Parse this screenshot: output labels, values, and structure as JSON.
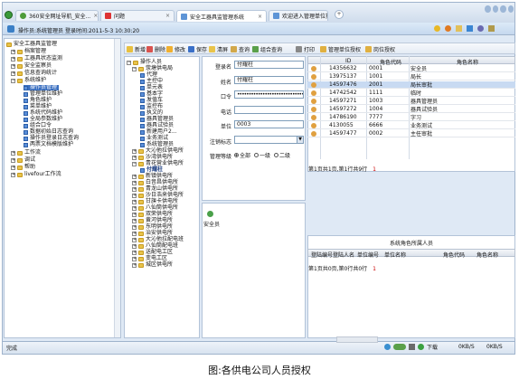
{
  "browser": {
    "tabs": [
      {
        "label": "360安全网址导航_安全..."
      },
      {
        "label": "问题"
      },
      {
        "label": "安全工器具监管理系统"
      },
      {
        "label": "欢迎进入管理单位授权"
      }
    ],
    "new_tab": "+"
  },
  "header": {
    "user": "操作员:系统管理员",
    "login_time": "登录时间:2011-5-3 10:30:20"
  },
  "left_tree": {
    "root": "安全工器具监管理",
    "items": [
      "档案管理",
      "工器具状态监测",
      "安全监察员",
      "信息查询统计",
      "系统维护",
      "操作员管理",
      "管理单位维护",
      "角色维护",
      "菜单维护",
      "系统代码维护",
      "全局参数维护",
      "组合口令",
      "数据初始日志查询",
      "操作员登录日志查询",
      "两票文档模版维护",
      "工作流",
      "调试",
      "帮助",
      "livefour工作流"
    ]
  },
  "toolbar": {
    "buttons": [
      "新增",
      "删除",
      "修改",
      "保存",
      "清屏",
      "查询",
      "组合查询",
      "打印",
      "管理单位授权",
      "岗位授权"
    ]
  },
  "org_tree": {
    "root": "操作人员",
    "items": [
      "荥塘供电局",
      "代理",
      "主控中",
      "单元表",
      "基本字",
      "发值车",
      "监控布",
      "执文的",
      "器具管理员",
      "器具试验员",
      "新建用户2...",
      "业务测试",
      "系统管理员",
      "大沁他拉供电所",
      "沙湾供电所",
      "青花营业供电所",
      "付耀柱",
      "新镇供电所",
      "白音昌供电所",
      "青龙山供电所",
      "沙日浩来供电所",
      "甘旗卡供电所",
      "八仙筒供电所",
      "双荣供电所",
      "黄河供电所",
      "东明供电所",
      "治安供电所",
      "大沁他拉配电班",
      "八仙筒配电班",
      "送配电工区",
      "变电工区",
      "城区供电所"
    ]
  },
  "form": {
    "login_name_label": "登录名",
    "login_name": "付耀柱",
    "name_label": "姓名",
    "name": "付耀柱",
    "password_label": "口令",
    "password": "••••••••••••••••••••••••••••••••••••••",
    "phone_label": "电话",
    "phone": "",
    "unit_label": "单位",
    "unit": "0003",
    "cancel_flag_label": "注销标志",
    "cancel_flag": "",
    "manage_level_label": "管理等级",
    "levels": [
      "全部",
      "一级",
      "二级"
    ]
  },
  "security_box": {
    "label": "安全员"
  },
  "role_grid": {
    "headers": [
      "",
      "ID",
      "角色代码",
      "角色名称"
    ],
    "rows": [
      {
        "id": "14356632",
        "code": "0001",
        "name": "安全员"
      },
      {
        "id": "13975137",
        "code": "1001",
        "name": "局长"
      },
      {
        "id": "14597476",
        "code": "2001",
        "name": "局长审批"
      },
      {
        "id": "14742542",
        "code": "1111",
        "name": "临时"
      },
      {
        "id": "14597271",
        "code": "1003",
        "name": "器具管理员"
      },
      {
        "id": "14597272",
        "code": "1004",
        "name": "器具试验员"
      },
      {
        "id": "14786190",
        "code": "7777",
        "name": "字习"
      },
      {
        "id": "4130055",
        "code": "6666",
        "name": "业务测试"
      },
      {
        "id": "14597477",
        "code": "0002",
        "name": "主任审批"
      }
    ],
    "pager": "第1页共1页,第1行共9行",
    "pager_count": "1"
  },
  "auth_grid": {
    "title": "系统角色所属人员",
    "headers": [
      "登陆编号",
      "登陆人名",
      "单位编号",
      "单位名称",
      "角色代码",
      "角色名称"
    ],
    "pager": "第1页共0页,第0行共0行",
    "pager_count": "1"
  },
  "status": {
    "left": "完成",
    "download": "下载",
    "speed1": "0KB/S",
    "speed2": "0KB/S"
  },
  "caption": "图:各供电公司人员授权"
}
